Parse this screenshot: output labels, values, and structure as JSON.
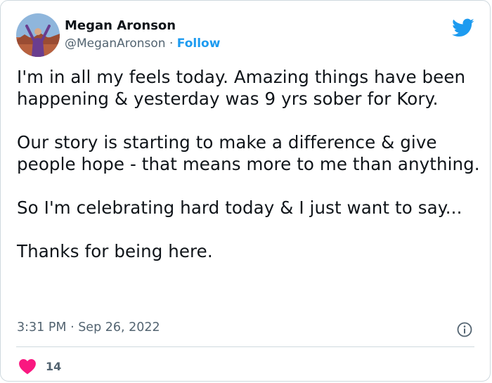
{
  "author": {
    "display_name": "Megan Aronson",
    "handle": "@MeganAronson",
    "separator": "·",
    "follow_label": "Follow"
  },
  "icons": {
    "brand": "twitter-bird-icon",
    "info": "info-icon",
    "like": "heart-icon"
  },
  "colors": {
    "accent": "#1d9bf0",
    "heart": "#f91880",
    "muted": "#536471"
  },
  "tweet": {
    "paragraphs": [
      "I'm in all my feels today. Amazing things have been happening & yesterday was 9 yrs sober for Kory.",
      "Our story is starting to make a difference & give people hope - that means more to me than anything.",
      "So I'm celebrating hard today & I just want to say...",
      "Thanks for being here."
    ],
    "timestamp": "3:31 PM · Sep 26, 2022",
    "like_count": "14"
  }
}
